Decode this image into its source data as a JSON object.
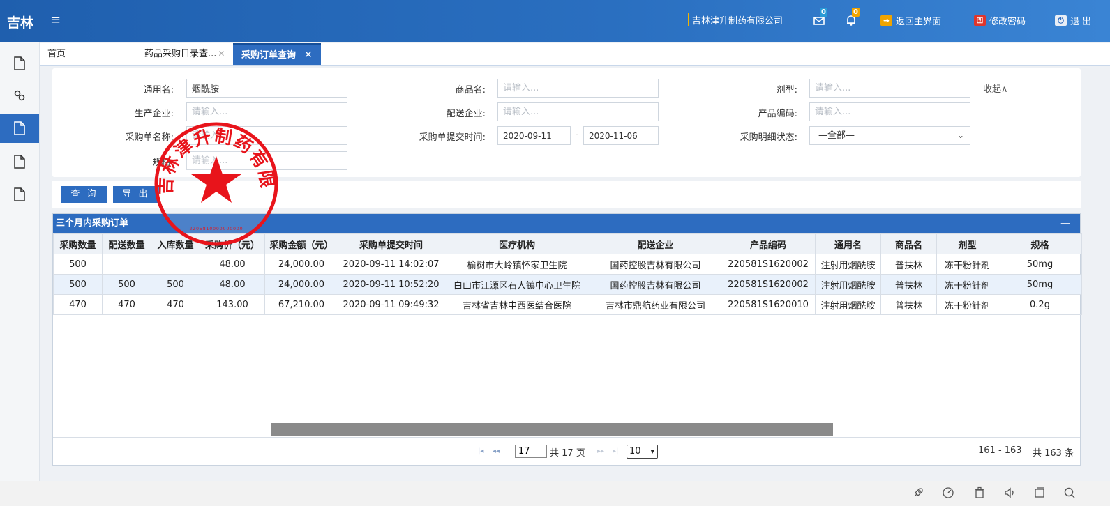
{
  "topbar": {
    "brand": "吉林",
    "menu_icon": "hamburger-icon",
    "company": "吉林津升制药有限公司",
    "mail_badge": "0",
    "bell_badge": "0",
    "home_label": "返回主界面",
    "password_label": "修改密码",
    "logout_label": "退 出"
  },
  "tabs": [
    {
      "label": "首页"
    },
    {
      "label": "药品采购目录查..."
    },
    {
      "label": "采购订单查询"
    }
  ],
  "search": {
    "generic_name_label": "通用名:",
    "generic_name_value": "烟酰胺",
    "trade_name_label": "商品名:",
    "dosage_form_label": "剂型:",
    "manufacturer_label": "生产企业:",
    "distributor_label": "配送企业:",
    "product_code_label": "产品编码:",
    "order_name_label": "采购单名称:",
    "submit_time_label": "采购单提交时间:",
    "date_from": "2020-09-11",
    "date_to": "2020-11-06",
    "date_sep": "-",
    "detail_status_label": "采购明细状态:",
    "detail_status_value": "—全部—",
    "spec_label": "规格:",
    "placeholder": "请输入...",
    "collapse_label": "收起∧",
    "query_button": "查 询",
    "export_button": "导 出"
  },
  "grid": {
    "title": "三个月内采购订单",
    "minimize": "—",
    "columns": [
      "采购数量",
      "配送数量",
      "入库数量",
      "采购价（元）",
      "采购金额（元）",
      "采购单提交时间",
      "医疗机构",
      "配送企业",
      "产品编码",
      "通用名",
      "商品名",
      "剂型",
      "规格"
    ],
    "rows": [
      [
        "500",
        "",
        "",
        "48.00",
        "24,000.00",
        "2020-09-11 14:02:07",
        "榆树市大岭镇怀家卫生院",
        "国药控股吉林有限公司",
        "220581S1620002",
        "注射用烟酰胺",
        "普扶林",
        "冻干粉针剂",
        "50mg"
      ],
      [
        "500",
        "500",
        "500",
        "48.00",
        "24,000.00",
        "2020-09-11 10:52:20",
        "白山市江源区石人镇中心卫生院",
        "国药控股吉林有限公司",
        "220581S1620002",
        "注射用烟酰胺",
        "普扶林",
        "冻干粉针剂",
        "50mg"
      ],
      [
        "470",
        "470",
        "470",
        "143.00",
        "67,210.00",
        "2020-09-11 09:49:32",
        "吉林省吉林中西医结合医院",
        "吉林市鼎航药业有限公司",
        "220581S1620010",
        "注射用烟酰胺",
        "普扶林",
        "冻干粉针剂",
        "0.2g"
      ]
    ]
  },
  "pager": {
    "current_page": "17",
    "total_pages": "共 17 页",
    "page_size": "10",
    "range": "161 - 163",
    "total": "共 163 条"
  },
  "stamp": {
    "text": "吉林津升制药有限公司"
  },
  "colors": {
    "primary": "#2d6cc0",
    "stamp_red": "#e8141b"
  }
}
